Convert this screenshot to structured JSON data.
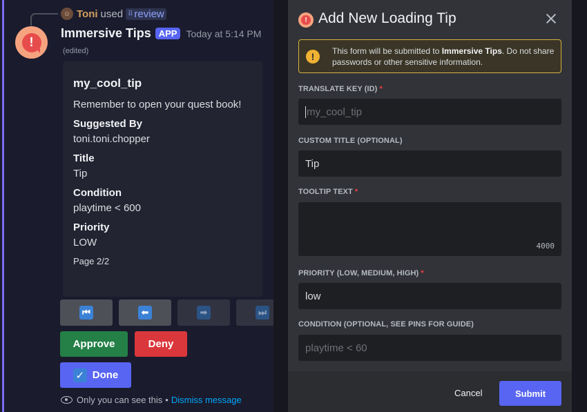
{
  "reply": {
    "user": "Toni",
    "used_text": "used",
    "command": "review"
  },
  "message": {
    "bot_name": "Immersive Tips",
    "badge": "APP",
    "timestamp": "Today at 5:14 PM",
    "edited": "(edited)"
  },
  "embed": {
    "title": "my_cool_tip",
    "description": "Remember to open your quest book!",
    "fields": [
      {
        "name": "Suggested By",
        "value": "toni.toni.chopper"
      },
      {
        "name": "Title",
        "value": "Tip"
      },
      {
        "name": "Condition",
        "value": "playtime < 600"
      },
      {
        "name": "Priority",
        "value": "LOW"
      }
    ],
    "footer": "Page 2/2"
  },
  "nav_buttons": [
    {
      "icon": "first-page-icon",
      "glyph": "⏮",
      "disabled": false
    },
    {
      "icon": "previous-page-icon",
      "glyph": "⬅",
      "disabled": false
    },
    {
      "icon": "next-page-icon",
      "glyph": "➡",
      "disabled": true
    },
    {
      "icon": "last-page-icon",
      "glyph": "⏭",
      "disabled": true
    }
  ],
  "actions": {
    "approve": "Approve",
    "deny": "Deny",
    "done": "Done"
  },
  "ephemeral": {
    "text": "Only you can see this",
    "separator": "•",
    "dismiss": "Dismiss message"
  },
  "modal": {
    "title": "Add New Loading Tip",
    "warning_prefix": "This form will be submitted to ",
    "warning_app": "Immersive Tips",
    "warning_suffix": ". Do not share passwords or other sensitive information.",
    "fields": {
      "translate_key": {
        "label": "TRANSLATE KEY (ID)",
        "required": "*",
        "value": "",
        "placeholder": "my_cool_tip"
      },
      "custom_title": {
        "label": "CUSTOM TITLE (OPTIONAL)",
        "value": "Tip"
      },
      "tooltip_text": {
        "label": "TOOLTIP TEXT",
        "required": "*",
        "value": "",
        "counter": "4000"
      },
      "priority": {
        "label": "PRIORITY (LOW, MEDIUM, HIGH)",
        "required": "*",
        "value": "low"
      },
      "condition": {
        "label": "CONDITION (OPTIONAL, SEE PINS FOR GUIDE)",
        "value": "",
        "placeholder": "playtime < 60"
      }
    },
    "cancel": "Cancel",
    "submit": "Submit"
  },
  "colors": {
    "accent": "#5865f2",
    "approve": "#248046",
    "deny": "#da373c",
    "warning_border": "#d9b341",
    "link": "#00a8fc"
  }
}
